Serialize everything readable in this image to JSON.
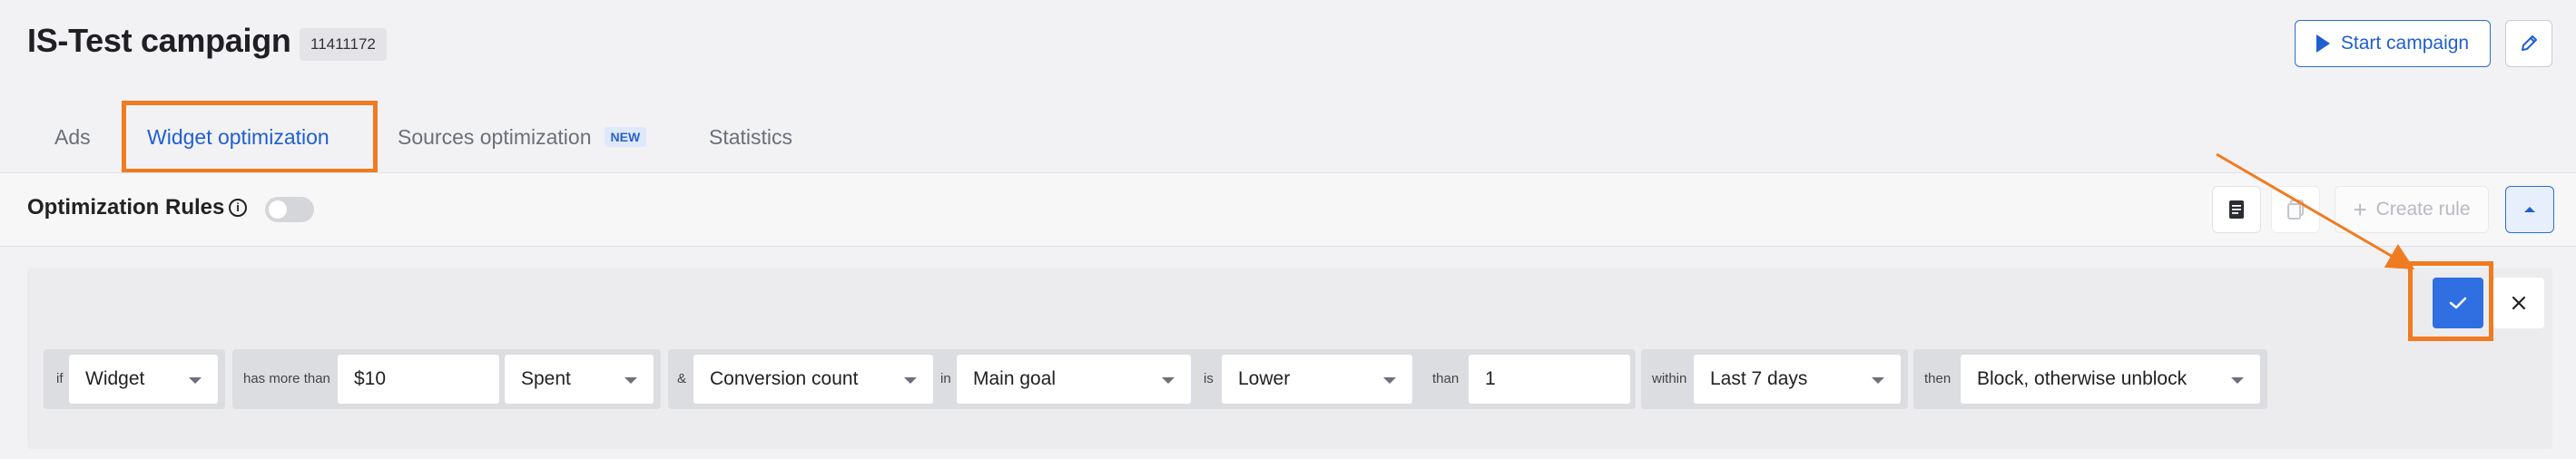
{
  "header": {
    "title": "IS-Test campaign",
    "campaign_id": "11411172",
    "start_button": "Start campaign"
  },
  "tabs": [
    {
      "label": "Ads"
    },
    {
      "label": "Widget optimization",
      "active": true
    },
    {
      "label": "Sources optimization",
      "badge": "NEW"
    },
    {
      "label": "Statistics"
    }
  ],
  "rules_bar": {
    "title": "Optimization Rules",
    "create_rule": "Create rule",
    "enabled": false
  },
  "rule": {
    "if_label": "if",
    "subject": "Widget",
    "has_more_than_label": "has more than",
    "amount": "$10",
    "metric": "Spent",
    "and_label": "&",
    "condition_metric": "Conversion count",
    "in_label": "in",
    "goal": "Main goal",
    "is_label": "is",
    "comparison": "Lower",
    "than_label": "than",
    "threshold": "1",
    "within_label": "within",
    "period": "Last 7 days",
    "then_label": "then",
    "action": "Block, otherwise unblock"
  },
  "colors": {
    "accent": "#1f5fd1",
    "highlight": "#f07b21"
  }
}
